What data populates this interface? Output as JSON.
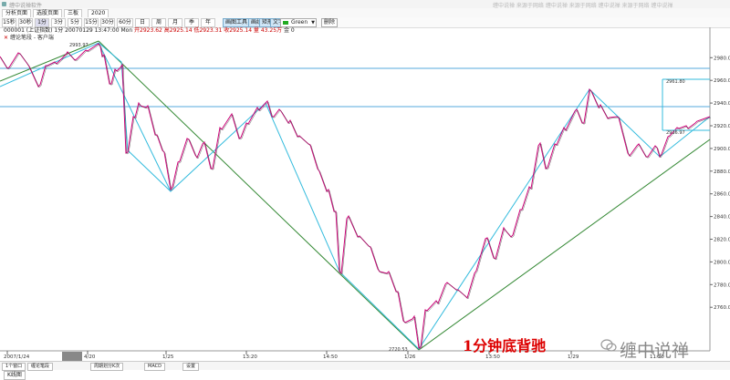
{
  "window": {
    "title": "缠中说禅软件",
    "right_text": "缠中说禅  来源于网络  缠中说禅  来源于网络  缠中说禅  来源于网络  缠中说禅"
  },
  "tabs": [
    {
      "label": "分析页面"
    },
    {
      "label": "选股页面"
    },
    {
      "label": "三板"
    },
    {
      "label": "2020"
    }
  ],
  "periods": [
    "15秒",
    "30秒",
    "1分",
    "3分",
    "5分",
    "15分",
    "30分",
    "60分",
    "日",
    "周",
    "月",
    "季",
    "年"
  ],
  "toolbar": {
    "draw_tools": "画图工具",
    "line_btn": "画线",
    "rect_btn": "矩形",
    "text_btn": "文字",
    "color_label": "Green",
    "color_value": "#22aa22",
    "delete_btn": "删除"
  },
  "info": {
    "symbol": "000001 (上证指数)",
    "period": "1分",
    "datetime": "20070129 13:47:00 Mon",
    "ohlc": "开2923.62 高2925.14 低2923.31 收2925.14 量",
    "volume": "43.25万",
    "flag": "金 0"
  },
  "indicator": {
    "name": "缠论笔段 - 客户端"
  },
  "price_axis": [
    {
      "label": "2980.00",
      "value": 2980
    },
    {
      "label": "2960.00",
      "value": 2960
    },
    {
      "label": "2940.00",
      "value": 2940
    },
    {
      "label": "2920.00",
      "value": 2920
    },
    {
      "label": "2900.00",
      "value": 2900
    },
    {
      "label": "2880.00",
      "value": 2880
    },
    {
      "label": "2860.00",
      "value": 2860
    },
    {
      "label": "2840.00",
      "value": 2840
    },
    {
      "label": "2820.00",
      "value": 2820
    },
    {
      "label": "2800.00",
      "value": 2800
    },
    {
      "label": "2780.00",
      "value": 2780
    },
    {
      "label": "2760.00",
      "value": 2760
    }
  ],
  "time_axis": [
    "2007/1/24",
    "4/20",
    "1/25",
    "13:20",
    "14:50",
    "1/26",
    "13:50",
    "1/29",
    "11:20"
  ],
  "annotations": {
    "high_label": "2993.97",
    "low_label": "2720.53",
    "box_top": "2961.80",
    "box_bottom": "2916.97"
  },
  "caption": "1分钟底背驰",
  "watermark": "缠中说禅",
  "bottom_tabs": [
    "1个窗口",
    "缠论笔段",
    "周期划分K次",
    "MACD",
    "设置"
  ],
  "kline_tab": "K线图",
  "colors": {
    "price_line": "#cc0077",
    "bi_line": "#33bbdd",
    "trend_line": "#338833",
    "hline": "#55aadd"
  }
}
